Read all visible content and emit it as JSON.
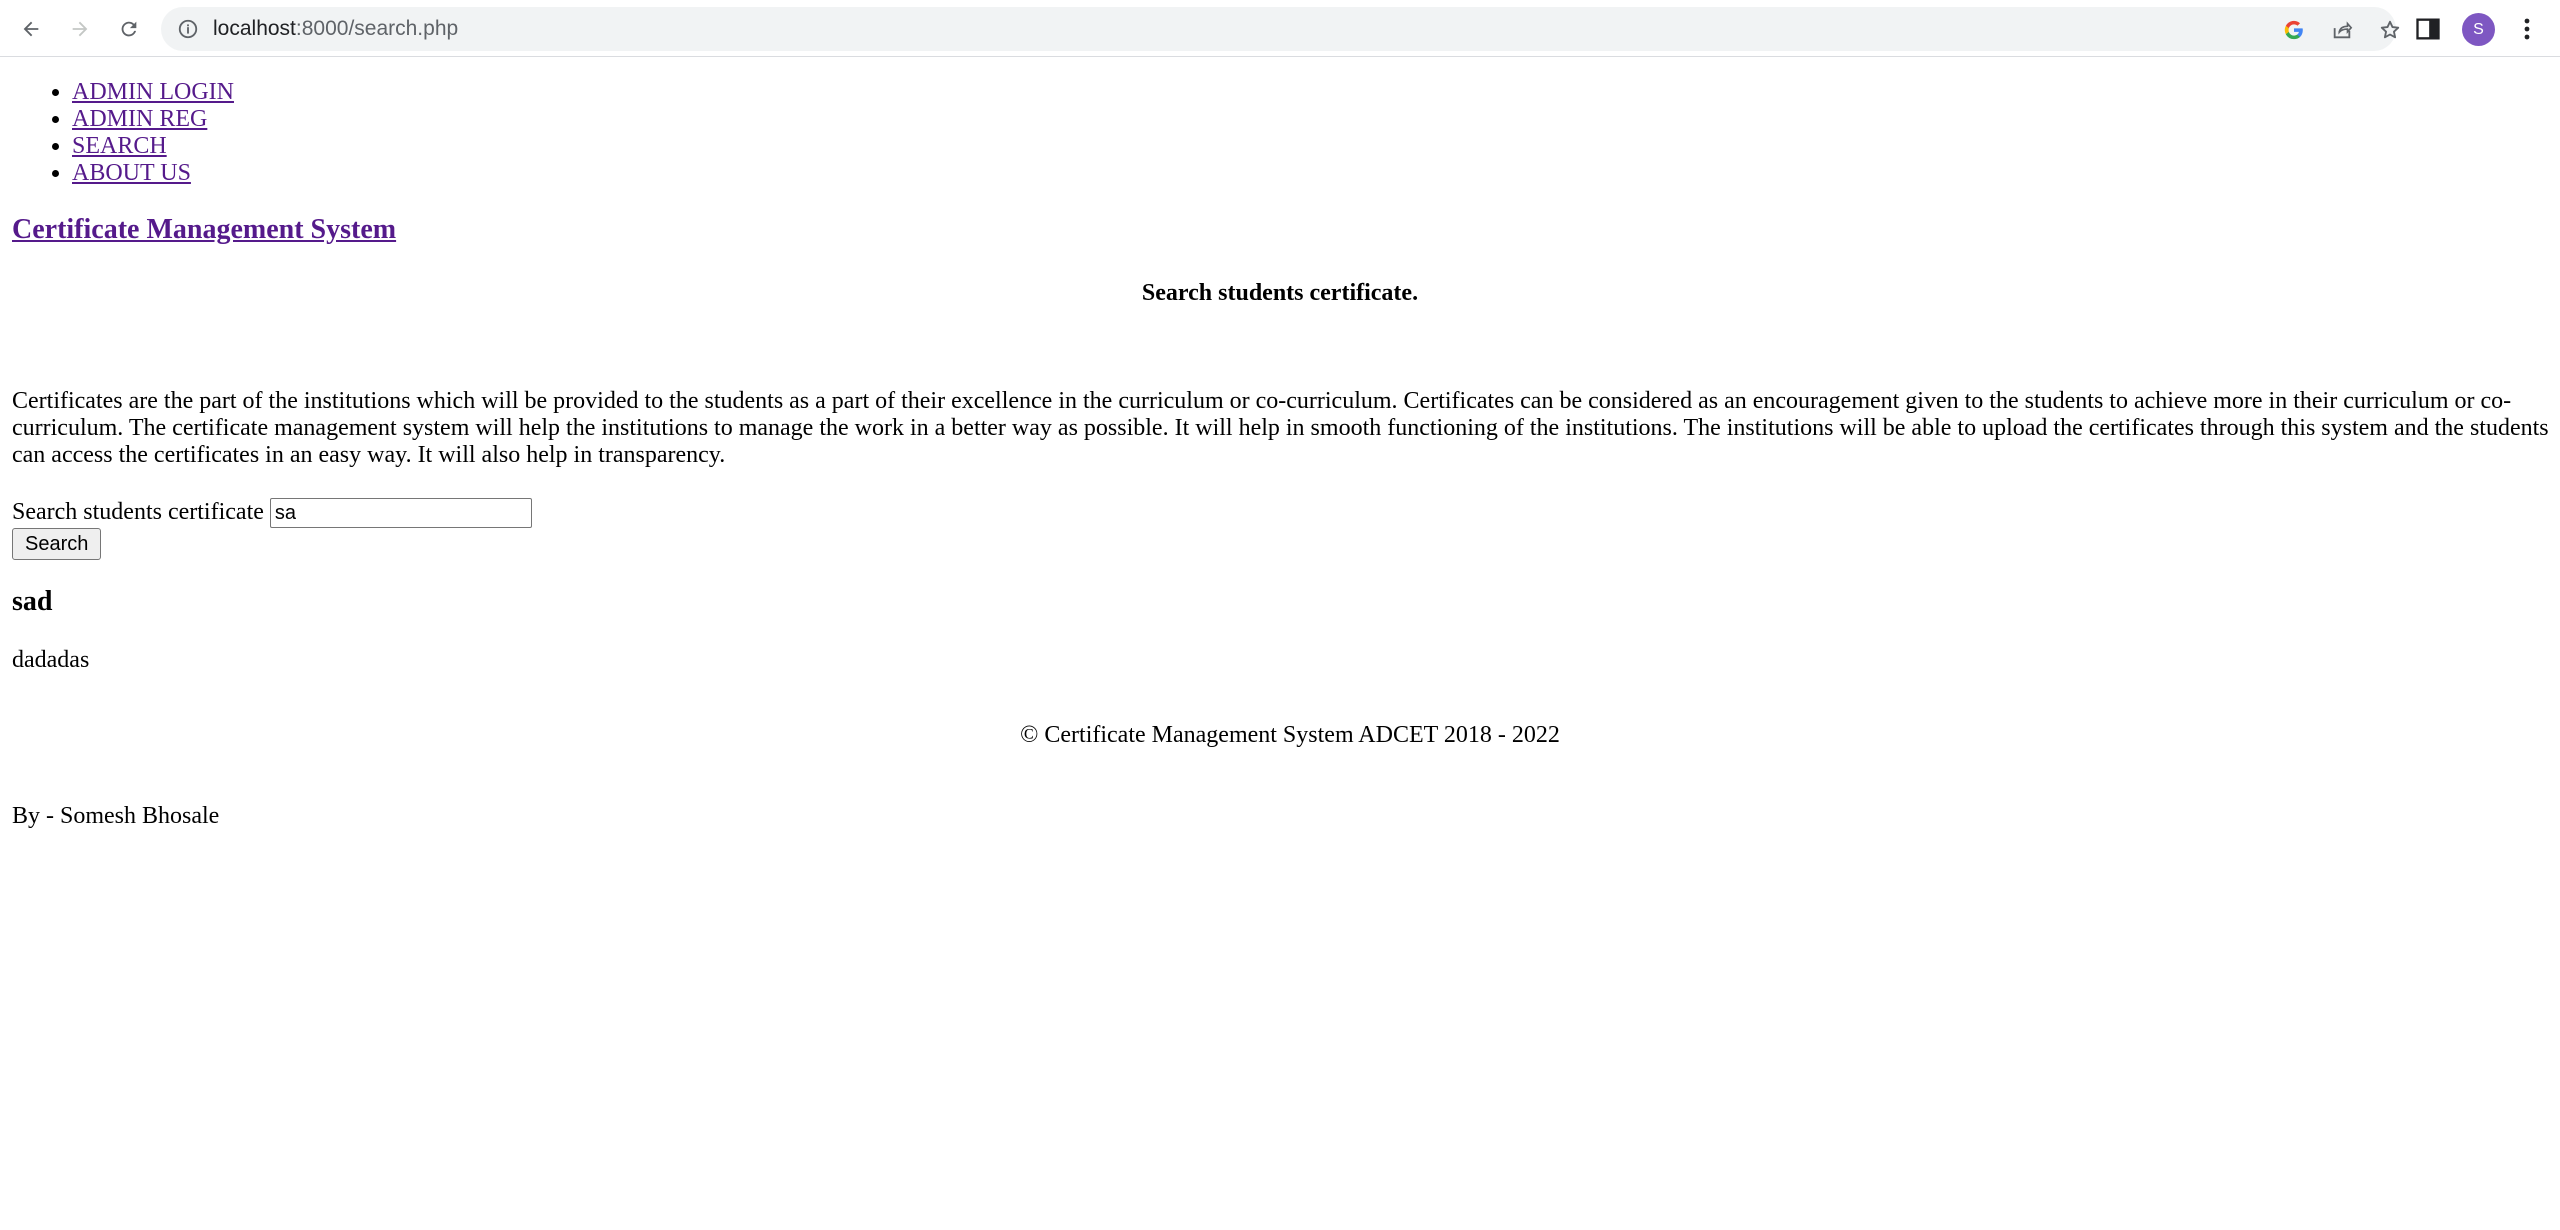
{
  "browser": {
    "url_host": "localhost",
    "url_path": ":8000/search.php",
    "profile_initial": "S"
  },
  "nav": {
    "items": [
      "ADMIN LOGIN",
      "ADMIN REG",
      "SEARCH",
      "ABOUT US"
    ]
  },
  "site_title": "Certificate Management System",
  "search_heading": "Search students certificate.",
  "intro": "Certificates are the part of the institutions which will be provided to the students as a part of their excellence in the curriculum or co-curriculum. Certificates can be considered as an encouragement given to the students to achieve more in their curriculum or co-curriculum. The certificate management system will help the institutions to manage the work in a better way as possible. It will help in smooth functioning of the institutions. The institutions will be able to upload the certificates through this system and the students can access the certificates in an easy way. It will also help in transparency.",
  "search": {
    "label": "Search students certificate",
    "value": "sa",
    "button_label": "Search"
  },
  "result": {
    "title": "sad",
    "text": "dadadas"
  },
  "footer": {
    "copyright": "© Certificate Management System ADCET 2018 - 2022",
    "author": "By - Somesh Bhosale"
  },
  "colors": {
    "link": "#551a8b",
    "avatar": "#7e57c2"
  }
}
